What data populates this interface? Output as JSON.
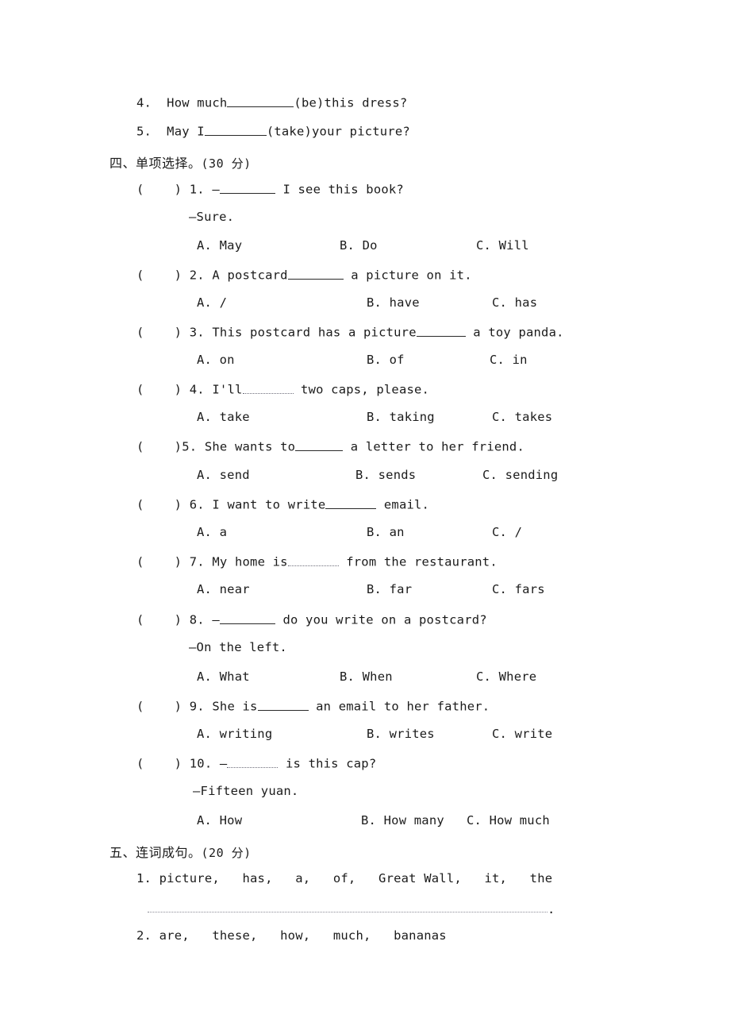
{
  "document": {
    "type": "english-worksheet-page",
    "language": "zh-CN/en"
  },
  "carryover_fill_in_items": [
    {
      "number": "4.",
      "before": "How much",
      "blank_width": 84,
      "after": "(be)this dress?"
    },
    {
      "number": "5.",
      "before": "May I",
      "blank_width": 78,
      "after": "(take)your picture?"
    }
  ],
  "section_four": {
    "heading": "四、单项选择。",
    "score": "(30 分)",
    "questions": [
      {
        "bracket": "(    )",
        "number": "1.",
        "stem_before": "—",
        "blank_width": 70,
        "stem_after": " I see this book?",
        "reply": "—Sure.",
        "options": [
          {
            "key": "A.",
            "text": "May"
          },
          {
            "key": "B.",
            "text": "Do"
          },
          {
            "key": "C.",
            "text": "Will"
          }
        ],
        "option_x": [
          248,
          428,
          600
        ]
      },
      {
        "bracket": "(    )",
        "number": "2.",
        "stem_before": "A postcard",
        "blank_width": 70,
        "stem_after": " a picture on it.",
        "reply": "",
        "options": [
          {
            "key": "A.",
            "text": "/"
          },
          {
            "key": "B.",
            "text": "have"
          },
          {
            "key": "C.",
            "text": "has"
          }
        ],
        "option_x": [
          248,
          462,
          620
        ]
      },
      {
        "bracket": "(    )",
        "number": "3.",
        "stem_before": "This postcard has a picture",
        "blank_width": 62,
        "stem_after": " a toy panda.",
        "reply": "",
        "options": [
          {
            "key": "A.",
            "text": "on"
          },
          {
            "key": "B.",
            "text": "of"
          },
          {
            "key": "C.",
            "text": "in"
          }
        ],
        "option_x": [
          248,
          462,
          617
        ]
      },
      {
        "bracket": "(    )",
        "number": "4.",
        "stem_before": "I'll",
        "blank_width": 64,
        "stem_after": " two caps, please.",
        "reply": "",
        "options": [
          {
            "key": "A.",
            "text": "take"
          },
          {
            "key": "B.",
            "text": "taking"
          },
          {
            "key": "C.",
            "text": "takes"
          }
        ],
        "option_x": [
          248,
          462,
          620
        ]
      },
      {
        "bracket": "(    )",
        "number": "5.",
        "no_gap_after_bracket": true,
        "stem_before": "She wants to",
        "blank_width": 60,
        "stem_after": " a letter to her friend.",
        "reply": "",
        "options": [
          {
            "key": "A.",
            "text": "send"
          },
          {
            "key": "B.",
            "text": "sends"
          },
          {
            "key": "C.",
            "text": "sending"
          }
        ],
        "option_x": [
          248,
          448,
          608
        ]
      },
      {
        "bracket": "(    )",
        "number": "6.",
        "stem_before": "I want to write",
        "blank_width": 64,
        "stem_after": " email.",
        "reply": "",
        "options": [
          {
            "key": "A.",
            "text": "a"
          },
          {
            "key": "B.",
            "text": "an"
          },
          {
            "key": "C.",
            "text": "/"
          }
        ],
        "option_x": [
          248,
          462,
          620
        ]
      },
      {
        "bracket": "(    )",
        "number": "7.",
        "stem_before": "My home is",
        "blank_width": 64,
        "dotted": true,
        "stem_after": " from the restaurant.",
        "reply": "",
        "options": [
          {
            "key": "A.",
            "text": "near"
          },
          {
            "key": "B.",
            "text": "far"
          },
          {
            "key": "C.",
            "text": "fars"
          }
        ],
        "option_x": [
          248,
          462,
          620
        ]
      },
      {
        "bracket": "(    )",
        "number": "8.",
        "stem_before": "—",
        "blank_width": 70,
        "stem_after": " do you write on a postcard?",
        "reply": "—On the left.",
        "options": [
          {
            "key": "A.",
            "text": "What"
          },
          {
            "key": "B.",
            "text": "When"
          },
          {
            "key": "C.",
            "text": "Where"
          }
        ],
        "option_x": [
          248,
          428,
          600
        ]
      },
      {
        "bracket": "(    )",
        "number": "9.",
        "stem_before": "She is",
        "blank_width": 64,
        "stem_after": " an email to her father.",
        "reply": "",
        "options": [
          {
            "key": "A.",
            "text": "writing"
          },
          {
            "key": "B.",
            "text": "writes"
          },
          {
            "key": "C.",
            "text": "write"
          }
        ],
        "option_x": [
          248,
          462,
          620
        ]
      },
      {
        "bracket": "(    )",
        "number": "10.",
        "stem_before": "—",
        "blank_width": 64,
        "dotted": true,
        "stem_after": " is this cap?",
        "reply": "—Fifteen yuan.",
        "options": [
          {
            "key": "A.",
            "text": "How"
          },
          {
            "key": "B.",
            "text": "How many"
          },
          {
            "key": "C.",
            "text": "How much"
          }
        ],
        "option_x": [
          248,
          455,
          588
        ]
      }
    ]
  },
  "section_five": {
    "heading": "五、连词成句。",
    "score": "(20 分)",
    "items": [
      {
        "number": "1.",
        "words": "picture,   has,   a,   of,   Great Wall,   it,   the",
        "has_answer_rule": true,
        "answer_terminator": "."
      },
      {
        "number": "2.",
        "words": "are,   these,   how,   much,   bananas",
        "has_answer_rule": false,
        "answer_terminator": ""
      }
    ]
  }
}
